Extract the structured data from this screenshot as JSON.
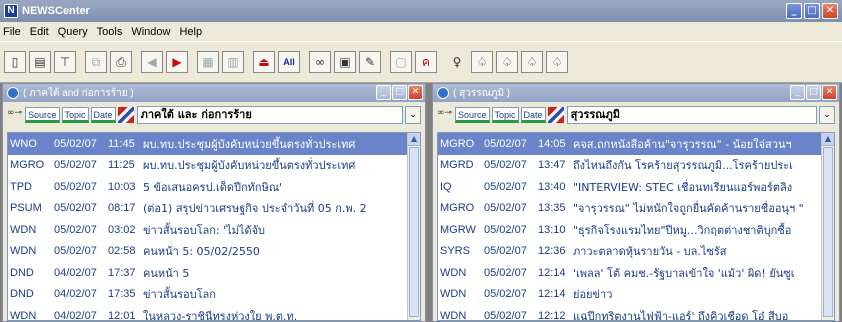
{
  "app": {
    "title": "NEWSCenter",
    "icon_letter": "N"
  },
  "window_controls": {
    "minimize": "_",
    "maximize": "□",
    "close": "✕"
  },
  "menu": [
    "File",
    "Edit",
    "Query",
    "Tools",
    "Window",
    "Help"
  ],
  "toolbar": {
    "all_label": "All",
    "icons": [
      "new-document-icon",
      "save-icon",
      "filter-icon",
      "copy-icon",
      "print-icon",
      "prev-icon",
      "next-icon",
      "layout-icon",
      "layout2-icon",
      "eject-icon",
      "all-icon",
      "binoculars-icon",
      "print-preview-icon",
      "clear-icon",
      "note-icon",
      "ryn-icon",
      "key-icon",
      "alert-icon"
    ]
  },
  "left_window": {
    "title": "( ภาคใต้ and ก่อการร้าย )",
    "filter_buttons": [
      "Source",
      "Topic",
      "Date"
    ],
    "filter_text": "ภาคใต้ และ ก่อการร้าย",
    "rows": [
      {
        "source": "WNO",
        "date": "05/02/07",
        "time": "11:45",
        "headline": "ผบ.ทบ.ประชุมผู้บังคับหน่วยขึ้นตรงทั่วประเทศ",
        "selected": true
      },
      {
        "source": "MGRO",
        "date": "05/02/07",
        "time": "11:25",
        "headline": "ผบ.ทบ.ประชุมผู้บังคับหน่วยขึ้นตรงทั่วประเทศ",
        "selected": false
      },
      {
        "source": "TPD",
        "date": "05/02/07",
        "time": "10:03",
        "headline": "5 ข้อเสนอครป.เด็ดปีกทักษิณ'",
        "selected": false
      },
      {
        "source": "PSUM",
        "date": "05/02/07",
        "time": "08:17",
        "headline": "(ต่อ1) สรุปข่าวเศรษฐกิจ ประจำวันที่ 05 ก.พ. 2",
        "selected": false
      },
      {
        "source": "WDN",
        "date": "05/02/07",
        "time": "03:02",
        "headline": "ข่าวสั้นรอบโลก: 'ไม่ได้จับ",
        "selected": false
      },
      {
        "source": "WDN",
        "date": "05/02/07",
        "time": "02:58",
        "headline": "คนหน้า 5: 05/02/2550",
        "selected": false
      },
      {
        "source": "DND",
        "date": "04/02/07",
        "time": "17:37",
        "headline": "คนหน้า 5",
        "selected": false
      },
      {
        "source": "DND",
        "date": "04/02/07",
        "time": "17:35",
        "headline": "ข่าวสั้นรอบโลก",
        "selected": false
      },
      {
        "source": "WDN",
        "date": "04/02/07",
        "time": "12:01",
        "headline": "ในหลวง-ราชินีทรงห่วงใย พ.ต.ท.",
        "selected": false
      }
    ]
  },
  "right_window": {
    "title": "( สุวรรณภูมิ )",
    "filter_buttons": [
      "Source",
      "Topic",
      "Date"
    ],
    "filter_text": "สุวรรณภูมิ",
    "rows": [
      {
        "source": "MGRO",
        "date": "05/02/07",
        "time": "14:05",
        "headline": "คจส.ถกหนังสือค้าน\"จารุวรรณ\" - น้อยใจ่สวนฯ",
        "selected": true
      },
      {
        "source": "MGRD",
        "date": "05/02/07",
        "time": "13:47",
        "headline": "ถึงไหนถึงกัน โรคร้ายสุวรรณภูมิ...โรคร้ายประเ",
        "selected": false
      },
      {
        "source": "IQ",
        "date": "05/02/07",
        "time": "13:40",
        "headline": "\"INTERVIEW: STEC เชื่อนทเรียนแอร์พอร์ตลิง",
        "selected": false
      },
      {
        "source": "MGRO",
        "date": "05/02/07",
        "time": "13:35",
        "headline": "\"จารุวรรณ\" ไม่หนักใจถูกยื่นคัดค้านรายชื่ออนุฯ \"",
        "selected": false
      },
      {
        "source": "MGRW",
        "date": "05/02/07",
        "time": "13:10",
        "headline": "\"ธุรกิจโรงแรมไทย\"ปีหมู...วิกฤตต่างชาติบุกซื้อ",
        "selected": false
      },
      {
        "source": "SYRS",
        "date": "05/02/07",
        "time": "12:36",
        "headline": "ภาวะตลาดหุ้นรายวัน - บล.ไซรัส",
        "selected": false
      },
      {
        "source": "WDN",
        "date": "05/02/07",
        "time": "12:14",
        "headline": "'เพลล' โต้ คมช.-รัฐบาลเข้าใจ 'แม้ว' ผิด! ยันซูเ",
        "selected": false
      },
      {
        "source": "WDN",
        "date": "05/02/07",
        "time": "12:14",
        "headline": "ย่อยข่าว",
        "selected": false
      },
      {
        "source": "WDN",
        "date": "05/02/07",
        "time": "12:12",
        "headline": "แฉปีกทริตงานไฟฟ้า-แอร์' ถึงคิวเชือด โอ๋ สีบอ",
        "selected": false
      }
    ]
  }
}
